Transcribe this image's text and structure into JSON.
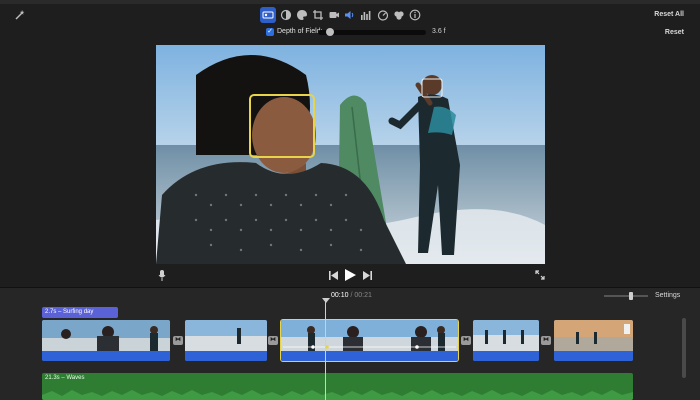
{
  "toolbar": {
    "icons": [
      "magic-wand-icon",
      "color-balance-icon",
      "color-correction-icon",
      "color-palette-icon",
      "crop-icon",
      "stabilization-icon",
      "volume-icon",
      "equalizer-icon",
      "speed-icon",
      "noise-reduction-icon",
      "info-icon"
    ],
    "active_icon": "color-balance-icon",
    "reset_all_label": "Reset All"
  },
  "depth_of_field": {
    "checked": true,
    "label": "Depth of Field:",
    "value": "3.6 f",
    "level": 0.1,
    "reset_label": "Reset"
  },
  "viewer": {
    "focus_color": "#e8d44a"
  },
  "playback": {
    "current_time": "00:10",
    "separator": "/",
    "total_time": "00:21",
    "settings_label": "Settings",
    "zoom_level": 0.6
  },
  "timeline": {
    "title_clip": "2.7s – Surfing day",
    "music_clip": "21.3s – Waves",
    "colors": {
      "title": "#5b62d8",
      "video_audio": "#2e62d6",
      "music": "#2e7d32",
      "selection": "#e8d44a"
    }
  }
}
